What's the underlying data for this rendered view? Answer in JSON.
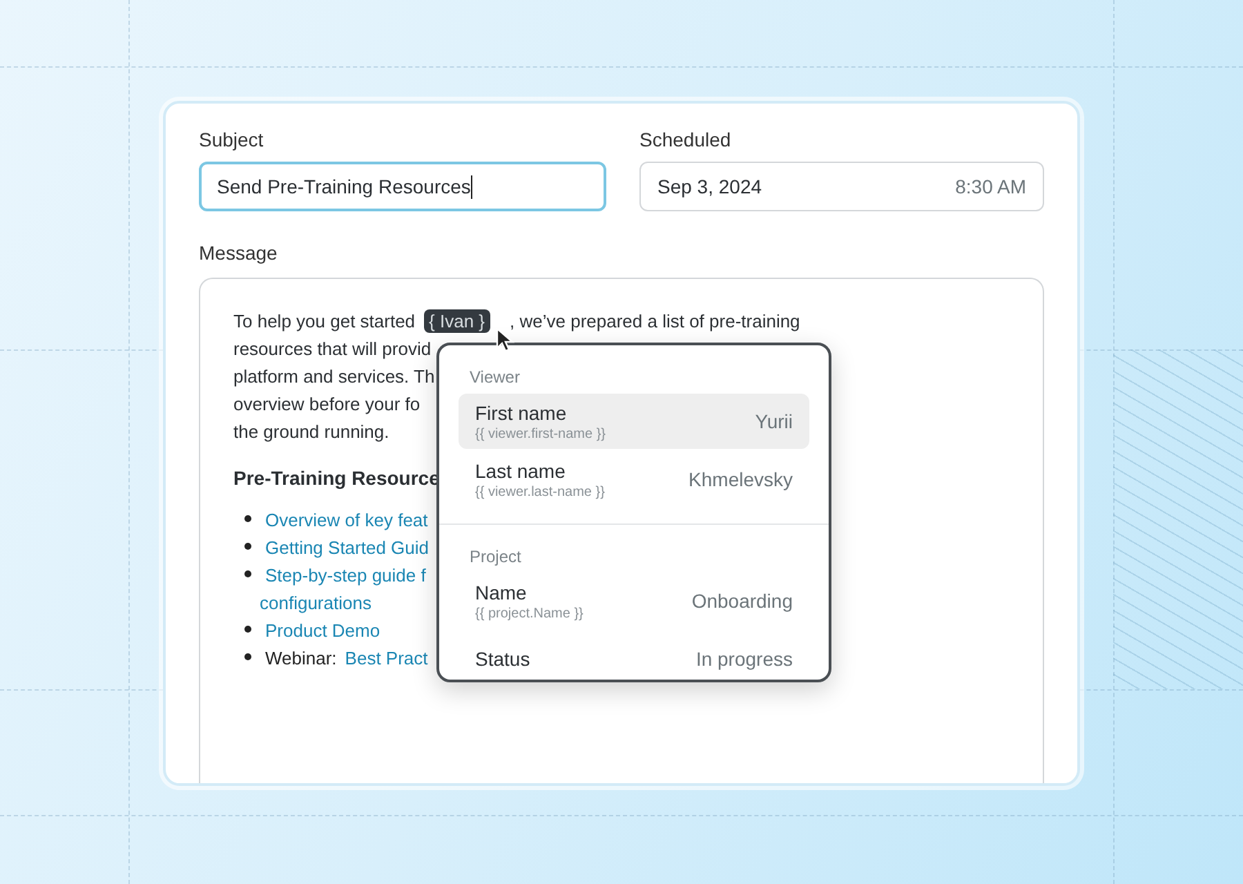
{
  "subject": {
    "label": "Subject",
    "value": "Send Pre-Training Resources",
    "focused": true
  },
  "scheduled": {
    "label": "Scheduled",
    "date": "Sep 3, 2024",
    "time": "8:30 AM"
  },
  "message": {
    "label": "Message",
    "intro": {
      "before": "To help you get started",
      "token": "{ Ivan }",
      "after": ", we’ve prepared a list of pre-training"
    },
    "lines": [
      "resources that will provid",
      "platform and services. Th",
      "overview before your fo",
      "the ground running."
    ],
    "heading": "Pre-Training Resource",
    "list": [
      {
        "kind": "link",
        "text": "Overview of key feat"
      },
      {
        "kind": "link",
        "text": "Getting Started Guid"
      },
      {
        "kind": "link",
        "text": "Step-by-step guide f",
        "continuation": "configurations"
      },
      {
        "kind": "link",
        "text": "Product Demo"
      },
      {
        "kind": "labeled_link",
        "label": "Webinar:",
        "text": "Best Pract"
      }
    ]
  },
  "popup": {
    "sections": [
      {
        "title": "Viewer",
        "items": [
          {
            "label": "First name",
            "token": "{{ viewer.first-name }}",
            "value": "Yurii",
            "selected": true
          },
          {
            "label": "Last name",
            "token": "{{ viewer.last-name }}",
            "value": "Khmelevsky",
            "selected": false
          }
        ]
      },
      {
        "title": "Project",
        "items": [
          {
            "label": "Name",
            "token": "{{ project.Name }}",
            "value": "Onboarding",
            "selected": false
          },
          {
            "label": "Status",
            "value": "In progress",
            "selected": false
          }
        ]
      }
    ]
  }
}
